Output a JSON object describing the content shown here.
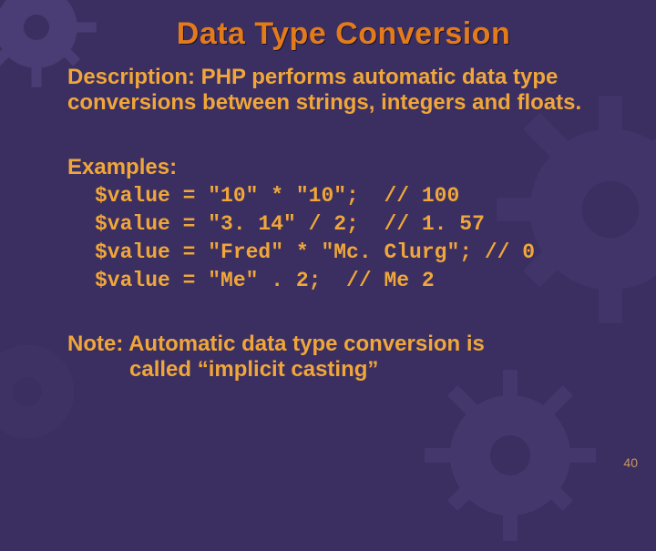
{
  "title": "Data Type Conversion",
  "description": "Description: PHP performs automatic data type conversions between strings, integers and floats.",
  "examples_label": "Examples:",
  "code_lines": [
    "$value = \"10\" * \"10\";  // 100",
    "$value = \"3. 14\" / 2;  // 1. 57",
    "$value = \"Fred\" * \"Mc. Clurg\"; // 0",
    "$value = \"Me\" . 2;  // Me 2"
  ],
  "note_line1": "Note: Automatic data type conversion is",
  "note_line2": "called “implicit casting”",
  "page_number": "40"
}
